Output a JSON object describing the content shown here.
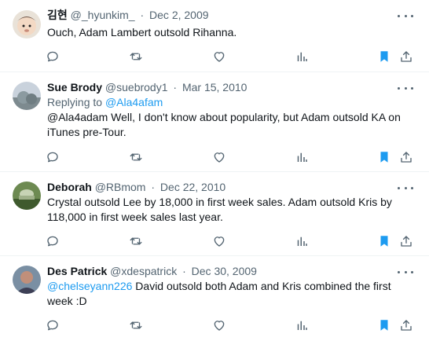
{
  "tweets": [
    {
      "name": "김현",
      "handle": "@_hyunkim_",
      "separator": "·",
      "date": "Dec 2, 2009",
      "text_plain": "Ouch, Adam Lambert outsold Rihanna."
    },
    {
      "name": "Sue Brody",
      "handle": "@suebrody1",
      "separator": "·",
      "date": "Mar 15, 2010",
      "reply_label": "Replying to",
      "reply_to": "@Ala4afam",
      "text_plain": "@Ala4adam Well, I don't know about popularity, but Adam outsold KA on iTunes pre-Tour."
    },
    {
      "name": "Deborah",
      "handle": "@RBmom",
      "separator": "·",
      "date": "Dec 22, 2010",
      "text_plain": "Crystal outsold Lee by 18,000 in first week sales. Adam outsold Kris by 118,000 in first week sales last year."
    },
    {
      "name": "Des Patrick",
      "handle": "@xdespatrick",
      "separator": "·",
      "date": "Dec 30, 2009",
      "mention": "@chelseyann226",
      "text_plain": " David outsold both Adam and Kris combined the first week :D"
    }
  ],
  "colors": {
    "accent": "#1d9bf0",
    "secondary_text": "#536471",
    "bookmark_active": "#1d9bf0",
    "divider": "#eff3f4"
  },
  "icons": [
    "more-icon",
    "reply-icon",
    "retweet-icon",
    "like-icon",
    "views-icon",
    "bookmark-icon",
    "share-icon"
  ]
}
